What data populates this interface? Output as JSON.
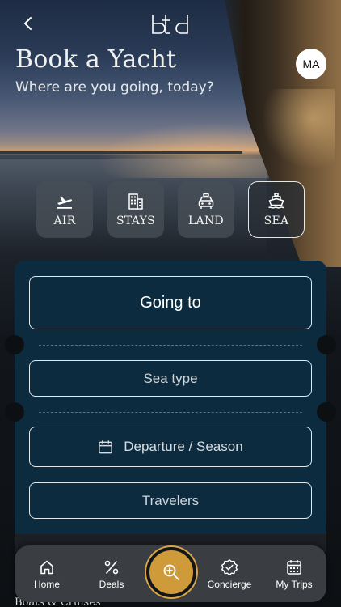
{
  "header": {
    "logo_text": "btd",
    "title": "Book a Yacht",
    "subtitle": "Where are you going, today?",
    "avatar_initials": "MA"
  },
  "modes": [
    {
      "label": "AIR",
      "icon": "plane-departure-icon"
    },
    {
      "label": "STAYS",
      "icon": "building-icon"
    },
    {
      "label": "LAND",
      "icon": "car-icon"
    },
    {
      "label": "SEA",
      "icon": "ship-icon",
      "active": true
    }
  ],
  "search": {
    "going_to": "Going to",
    "sea_type": "Sea type",
    "departure": "Departure / Season",
    "travelers": "Travelers"
  },
  "peek_text": "Boats & Cruises",
  "nav": {
    "home": "Home",
    "deals": "Deals",
    "concierge": "Concierge",
    "my_trips": "My Trips"
  },
  "colors": {
    "card": "#0d2b3f",
    "accent_gold": "#cf9a3a",
    "nav_bg": "#3a3d41"
  }
}
